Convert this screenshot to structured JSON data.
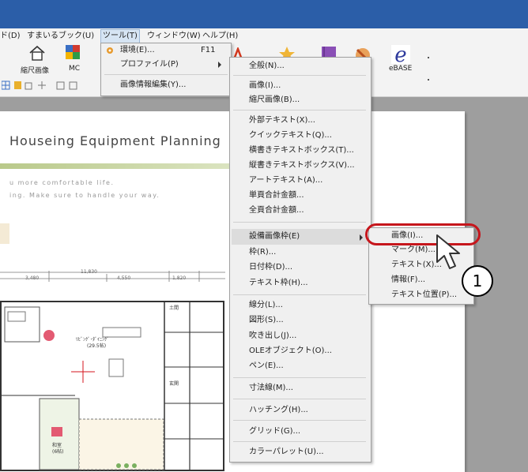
{
  "menubar": {
    "items": [
      {
        "label": "ド(D)"
      },
      {
        "label": "すまいるブック(U)"
      },
      {
        "label": "ツール(T)"
      },
      {
        "label": "ウィンドウ(W)"
      },
      {
        "label": "ヘルプ(H)"
      }
    ]
  },
  "ribbon": {
    "shukushaku_label": "縮尺画像",
    "mc_label": "MC",
    "ebase_label": "eBASE"
  },
  "tools_menu": {
    "items": [
      {
        "label": "環境(E)...",
        "shortcut": "F11"
      },
      {
        "label": "プロファイル(P)"
      },
      {
        "label": "画像情報編集(Y)..."
      }
    ]
  },
  "profile_menu": {
    "items": [
      "全般(N)...",
      "画像(I)...",
      "縮尺画像(B)...",
      "外部テキスト(X)...",
      "クイックテキスト(Q)...",
      "横書きテキストボックス(T)...",
      "縦書きテキストボックス(V)...",
      "アートテキスト(A)...",
      "単頁合計金額...",
      "全頁合計金額...",
      "設備画像枠(E)",
      "枠(R)...",
      "日付枠(D)...",
      "テキスト枠(H)...",
      "線分(L)...",
      "図形(S)...",
      "吹き出し(J)...",
      "OLEオブジェクト(O)...",
      "ペン(E)...",
      "寸法線(M)...",
      "ハッチング(H)...",
      "グリッド(G)...",
      "カラーパレット(U)..."
    ]
  },
  "equipment_menu": {
    "items": [
      "画像(I)...",
      "マーク(M)...",
      "テキスト(X)...",
      "情報(F)...",
      "テキスト位置(P)..."
    ]
  },
  "document": {
    "title": "Houseing Equipment Planning",
    "line1": "u more comfortable life.",
    "line2": "ing. Make sure to handle your way.",
    "dims": [
      "3,480",
      "11,830",
      "4,550",
      "1,820"
    ],
    "room_labels": [
      "ﾘﾋﾞﾝｸﾞ･ﾀﾞｲﾆﾝｸﾞ",
      "(29.5帖)",
      "土間",
      "和室",
      "(6帖)",
      "玄関"
    ]
  },
  "callout": {
    "step": "1"
  },
  "colors": {
    "title_bar": "#2b5ea8",
    "callout": "#c6161c",
    "highlight": "#dcdcdc"
  }
}
